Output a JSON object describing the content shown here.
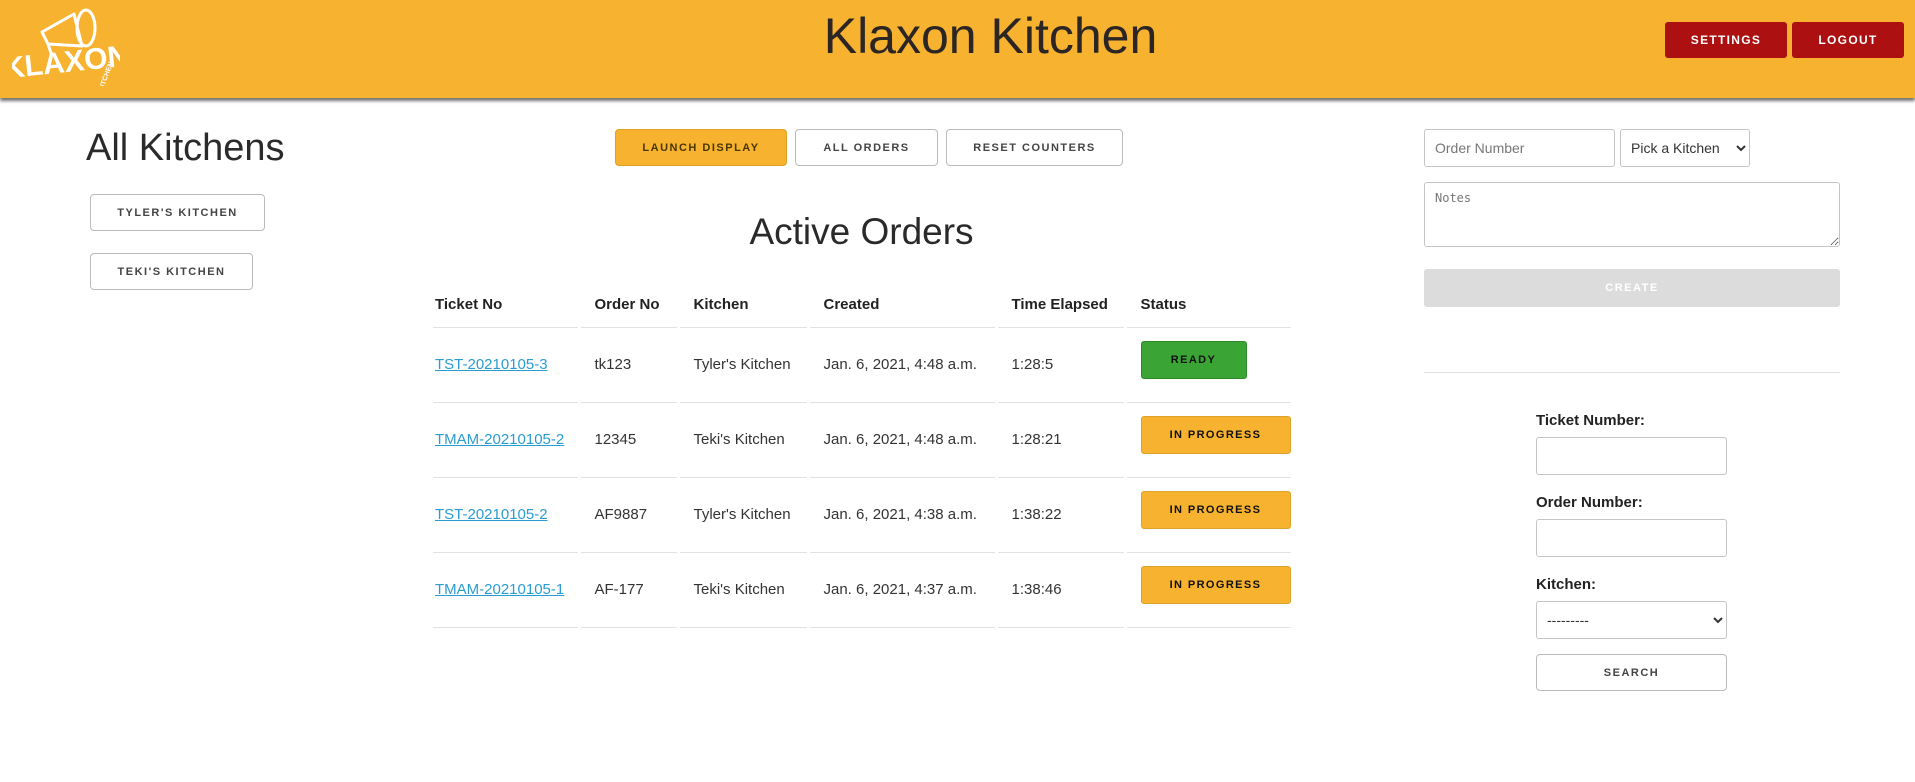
{
  "header": {
    "title": "Klaxon Kitchen",
    "logo_text": "KLAXON",
    "logo_subtext": "KITCHEN",
    "settings_label": "SETTINGS",
    "logout_label": "LOGOUT",
    "brand_color": "#f7b230",
    "button_color": "#ac1010"
  },
  "sidebar": {
    "title": "All Kitchens",
    "kitchens": [
      "TYLER'S KITCHEN",
      "TEKI'S KITCHEN"
    ]
  },
  "toolbar": {
    "launch_display": "LAUNCH DISPLAY",
    "all_orders": "ALL ORDERS",
    "reset_counters": "RESET COUNTERS"
  },
  "orders": {
    "title": "Active Orders",
    "columns": [
      "Ticket No",
      "Order No",
      "Kitchen",
      "Created",
      "Time Elapsed",
      "Status"
    ],
    "rows": [
      {
        "ticket": "TST-20210105-3",
        "order": "tk123",
        "kitchen": "Tyler's Kitchen",
        "created": "Jan. 6, 2021, 4:48 a.m.",
        "elapsed": "1:28:5",
        "status": "READY"
      },
      {
        "ticket": "TMAM-20210105-2",
        "order": "12345",
        "kitchen": "Teki's Kitchen",
        "created": "Jan. 6, 2021, 4:48 a.m.",
        "elapsed": "1:28:21",
        "status": "IN PROGRESS"
      },
      {
        "ticket": "TST-20210105-2",
        "order": "AF9887",
        "kitchen": "Tyler's Kitchen",
        "created": "Jan. 6, 2021, 4:38 a.m.",
        "elapsed": "1:38:22",
        "status": "IN PROGRESS"
      },
      {
        "ticket": "TMAM-20210105-1",
        "order": "AF-177",
        "kitchen": "Teki's Kitchen",
        "created": "Jan. 6, 2021, 4:37 a.m.",
        "elapsed": "1:38:46",
        "status": "IN PROGRESS"
      }
    ]
  },
  "create_form": {
    "order_number_placeholder": "Order Number",
    "kitchen_select": "Pick a Kitchen",
    "notes_placeholder": "Notes",
    "create_label": "CREATE"
  },
  "search_form": {
    "ticket_label": "Ticket Number:",
    "order_label": "Order Number:",
    "kitchen_label": "Kitchen:",
    "kitchen_select": "---------",
    "search_label": "SEARCH"
  }
}
